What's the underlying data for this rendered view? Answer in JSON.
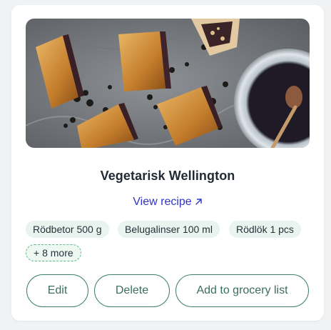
{
  "recipe": {
    "title": "Vegetarisk Wellington",
    "view_link": "View recipe",
    "view_link_icon": "external-arrow-icon",
    "image_subject": "pastry slices on baking paper with a bowl of dark sauce and spoon"
  },
  "ingredients": [
    {
      "label": "Rödbetor 500 g"
    },
    {
      "label": "Belugalinser 100 ml"
    },
    {
      "label": "Rödlök 1 pcs"
    }
  ],
  "more_ingredients": "+ 8 more",
  "actions": {
    "edit": "Edit",
    "delete": "Delete",
    "grocery": "Add to grocery list"
  },
  "colors": {
    "accent_green": "#3f8266",
    "chip_bg": "#e9f4ee",
    "link_blue": "#2f33c9",
    "title": "#222a33"
  }
}
